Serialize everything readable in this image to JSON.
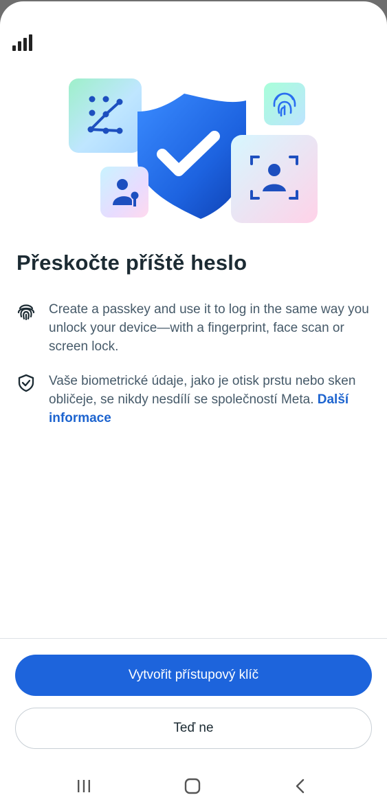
{
  "status_bar": {
    "signal_icon": "signal-bars-icon"
  },
  "hero": {
    "icons": [
      "pattern-lock-icon",
      "shield-check-icon",
      "fingerprint-icon",
      "face-scan-icon",
      "user-key-icon"
    ]
  },
  "title": "Přeskočte příště heslo",
  "info": [
    {
      "icon": "fingerprint-icon",
      "text": "Create a passkey and use it to log in the same way you unlock your device—with a fingerprint, face scan or screen lock."
    },
    {
      "icon": "shield-check-icon",
      "text": "Vaše biometrické údaje, jako je otisk prstu nebo sken obličeje, se nikdy nesdílí se společností Meta.",
      "link": "Další informace"
    }
  ],
  "buttons": {
    "primary": "Vytvořit přístupový klíč",
    "secondary": "Teď ne"
  },
  "navbar": {
    "icons": [
      "recent-apps-icon",
      "home-icon",
      "back-icon"
    ]
  },
  "colors": {
    "accent": "#1d64dc",
    "link": "#1d64cf",
    "text": "#1c2b33",
    "muted": "#465a69"
  }
}
